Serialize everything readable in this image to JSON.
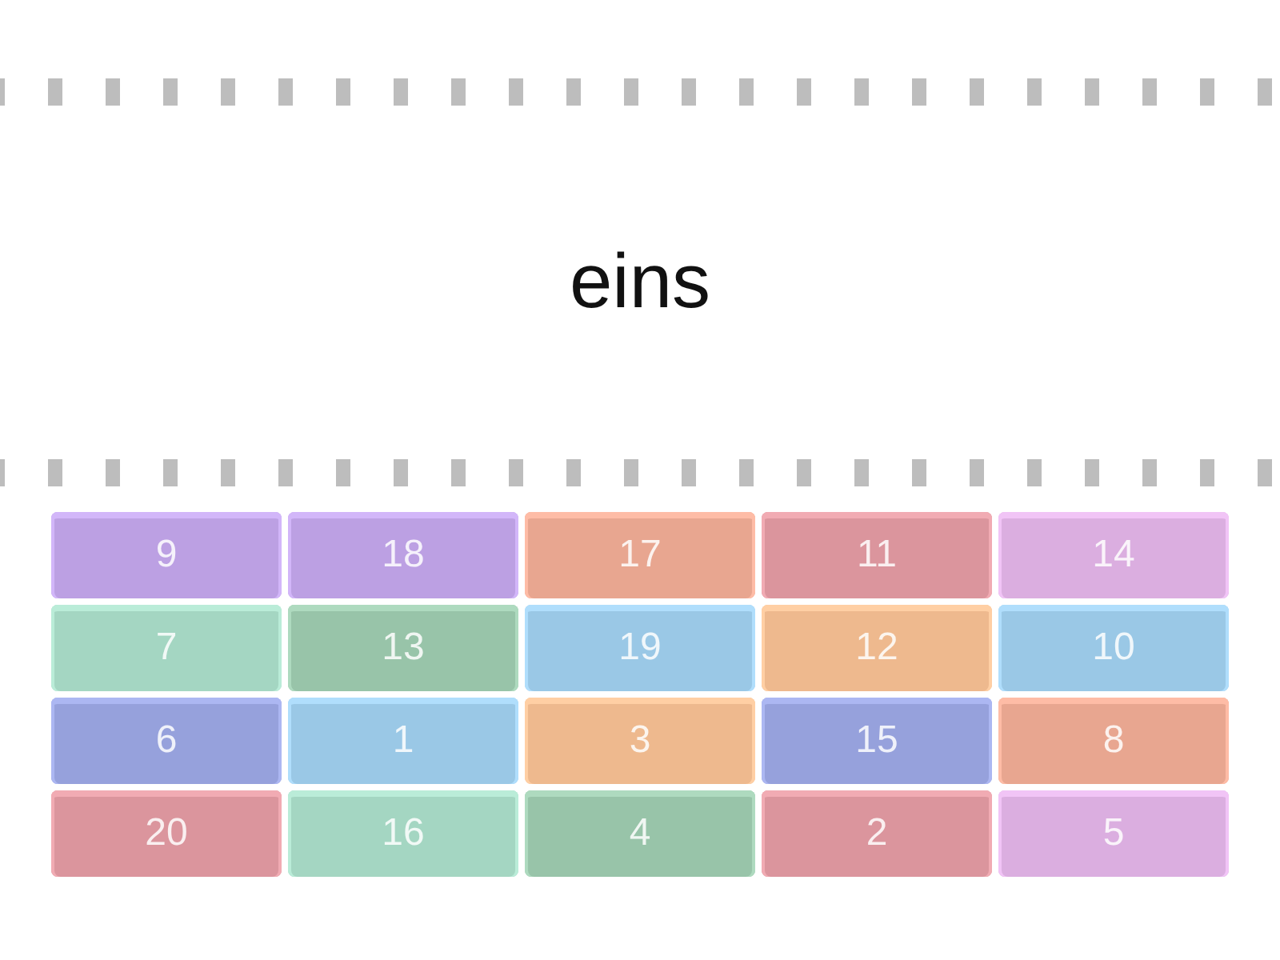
{
  "prompt": "eins",
  "tiles": [
    {
      "label": "9",
      "color": "#bca0e3"
    },
    {
      "label": "18",
      "color": "#bca0e3"
    },
    {
      "label": "17",
      "color": "#e8a690"
    },
    {
      "label": "11",
      "color": "#db959d"
    },
    {
      "label": "14",
      "color": "#dbaee0"
    },
    {
      "label": "7",
      "color": "#a4d6c2"
    },
    {
      "label": "13",
      "color": "#98c4a9"
    },
    {
      "label": "19",
      "color": "#9ac8e6"
    },
    {
      "label": "12",
      "color": "#eeb98e"
    },
    {
      "label": "10",
      "color": "#9ac8e6"
    },
    {
      "label": "6",
      "color": "#96a1dc"
    },
    {
      "label": "1",
      "color": "#9ac8e6"
    },
    {
      "label": "3",
      "color": "#eeb98e"
    },
    {
      "label": "15",
      "color": "#96a1dc"
    },
    {
      "label": "8",
      "color": "#e8a690"
    },
    {
      "label": "20",
      "color": "#db959d"
    },
    {
      "label": "16",
      "color": "#a4d6c2"
    },
    {
      "label": "4",
      "color": "#98c4a9"
    },
    {
      "label": "2",
      "color": "#db959d"
    },
    {
      "label": "5",
      "color": "#dbaee0"
    }
  ]
}
